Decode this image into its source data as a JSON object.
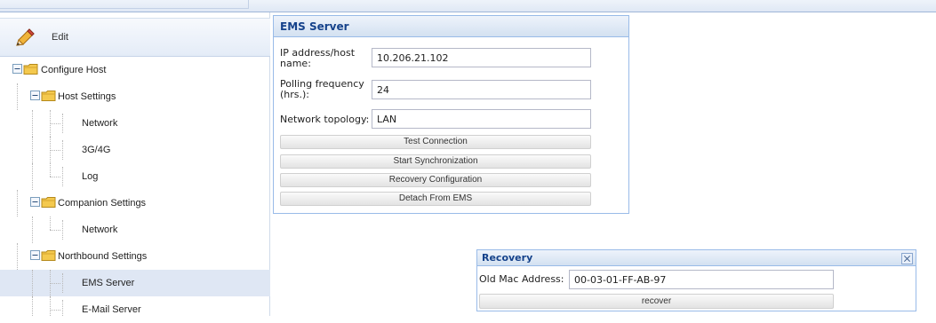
{
  "left_panel": {
    "edit_label": "Edit",
    "tree": [
      {
        "label": "Configure Host",
        "type": "folder"
      },
      {
        "label": "Host Settings",
        "type": "folder"
      },
      {
        "label": "Network",
        "type": "leaf"
      },
      {
        "label": "3G/4G",
        "type": "leaf"
      },
      {
        "label": "Log",
        "type": "leaf"
      },
      {
        "label": "Companion Settings",
        "type": "folder"
      },
      {
        "label": "Network",
        "type": "leaf"
      },
      {
        "label": "Northbound Settings",
        "type": "folder"
      },
      {
        "label": "EMS Server",
        "type": "leaf",
        "selected": true
      },
      {
        "label": "E-Mail Server",
        "type": "leaf"
      }
    ]
  },
  "ems_panel": {
    "title": "EMS Server",
    "fields": [
      {
        "label": "IP address/host name:",
        "value": "10.206.21.102"
      },
      {
        "label": "Polling frequency (hrs.):",
        "value": "24"
      },
      {
        "label": "Network topology:",
        "value": "LAN"
      }
    ],
    "buttons": [
      "Test Connection",
      "Start Synchronization",
      "Recovery Configuration",
      "Detach From EMS"
    ]
  },
  "recovery_dialog": {
    "title": "Recovery",
    "mac_label": "Old Mac Address:",
    "mac_value": "00-03-01-FF-AB-97",
    "recover_label": "recover"
  },
  "icons": {
    "edit": "pencil-icon",
    "folder": "folder-icon",
    "collapse": "minus-box-icon",
    "close": "close-icon"
  },
  "colors": {
    "panel_title": "#15428b",
    "panel_border": "#99bbe8",
    "selected_row": "#dfe7f4",
    "folder": "#f4c94e"
  }
}
